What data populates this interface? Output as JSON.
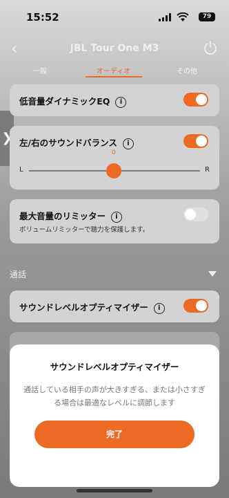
{
  "status_bar": {
    "time": "15:52",
    "battery": "79"
  },
  "nav": {
    "title": "JBL Tour One M3",
    "back_icon": "chevron-left-icon",
    "power_icon": "power-icon"
  },
  "tabs": [
    {
      "label": "一般"
    },
    {
      "label": "オーディオ",
      "active": true
    },
    {
      "label": "その他"
    }
  ],
  "cards": {
    "low_volume_eq": {
      "label": "低音量ダイナミックEQ",
      "enabled": true
    },
    "balance": {
      "label": "左/右のサウンドバランス",
      "enabled": true,
      "value": "0",
      "left": "L",
      "right": "R"
    },
    "max_volume_limiter": {
      "label": "最大音量のリミッター",
      "sublabel": "ボリュームリミッターで聴力を保護します。",
      "enabled": false
    }
  },
  "section": {
    "label": "通話"
  },
  "call_cards": {
    "sound_level_optimizer": {
      "label": "サウンドレベルオプティマイザー",
      "enabled": true
    }
  },
  "modal": {
    "title": "サウンドレベルオプティマイザー",
    "body": "通話している相手の声が大きすぎる、または小さすぎる場合は最適なレベルに調節します",
    "button": "完了"
  },
  "colors": {
    "accent": "#ec6a24"
  }
}
